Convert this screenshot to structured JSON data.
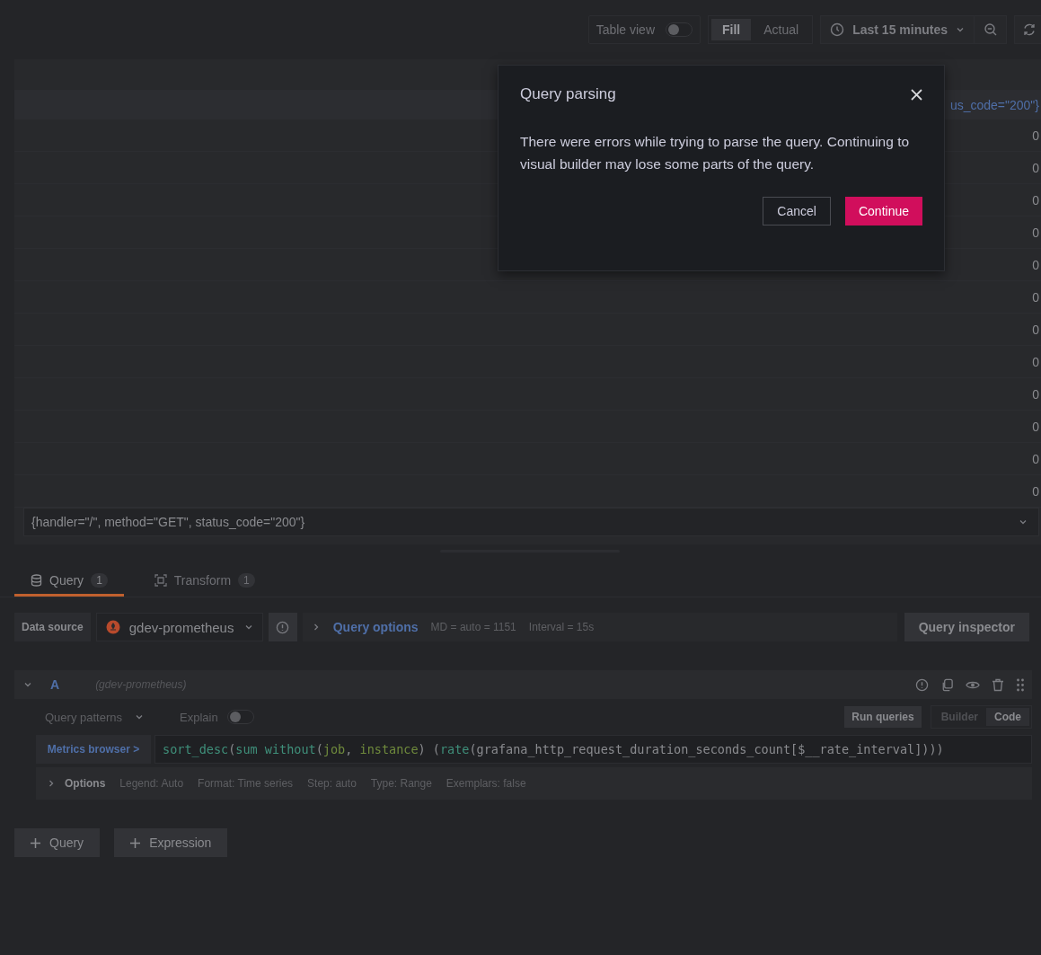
{
  "toolbar": {
    "table_view": {
      "label": "Table view",
      "on": false
    },
    "size_modes": [
      {
        "label": "Fill",
        "selected": true
      },
      {
        "label": "Actual",
        "selected": false
      }
    ],
    "time_range": "Last 15 minutes"
  },
  "table": {
    "header": "us_code=\"200\"}",
    "rows": [
      "0",
      "0",
      "0",
      "0",
      "0",
      "0",
      "0",
      "0",
      "0",
      "0",
      "0",
      "0"
    ],
    "series_select": "{handler=\"/\", method=\"GET\", status_code=\"200\"}"
  },
  "tabs": [
    {
      "label": "Query",
      "count": "1",
      "selected": true,
      "kind": "query"
    },
    {
      "label": "Transform",
      "count": "1",
      "selected": false,
      "kind": "transform"
    }
  ],
  "data_source": {
    "label": "Data source",
    "value": "gdev-prometheus",
    "options_label": "Query options",
    "md": "MD = auto = 1151",
    "interval": "Interval = 15s",
    "inspector": "Query inspector"
  },
  "query": {
    "ref": "A",
    "source": "(gdev-prometheus)",
    "expanded": true,
    "patterns": "Query patterns",
    "explain": {
      "label": "Explain",
      "on": false
    },
    "run": "Run queries",
    "modes": [
      {
        "label": "Builder",
        "selected": false
      },
      {
        "label": "Code",
        "selected": true
      }
    ],
    "metrics_browser": "Metrics browser >",
    "code": [
      {
        "kind": "fn",
        "text": "sort_desc"
      },
      {
        "kind": "punct",
        "text": "("
      },
      {
        "kind": "fn",
        "text": "sum without"
      },
      {
        "kind": "punct",
        "text": "("
      },
      {
        "kind": "label",
        "text": "job"
      },
      {
        "kind": "punct",
        "text": ", "
      },
      {
        "kind": "label",
        "text": "instance"
      },
      {
        "kind": "punct",
        "text": ") ("
      },
      {
        "kind": "fn",
        "text": "rate"
      },
      {
        "kind": "punct",
        "text": "(grafana_http_request_duration_seconds_count[$__rate_interval])))"
      }
    ],
    "options": {
      "label": "Options",
      "expanded": false,
      "items": [
        "Legend: Auto",
        "Format: Time series",
        "Step: auto",
        "Type: Range",
        "Exemplars: false"
      ]
    }
  },
  "add_buttons": [
    "Query",
    "Expression"
  ],
  "dialog": {
    "title": "Query parsing",
    "message": "There were errors while trying to parse the query. Continuing to visual builder may lose some parts of the query.",
    "buttons": [
      {
        "label": "Cancel",
        "kind": "secondary"
      },
      {
        "label": "Continue",
        "kind": "primary"
      }
    ]
  }
}
